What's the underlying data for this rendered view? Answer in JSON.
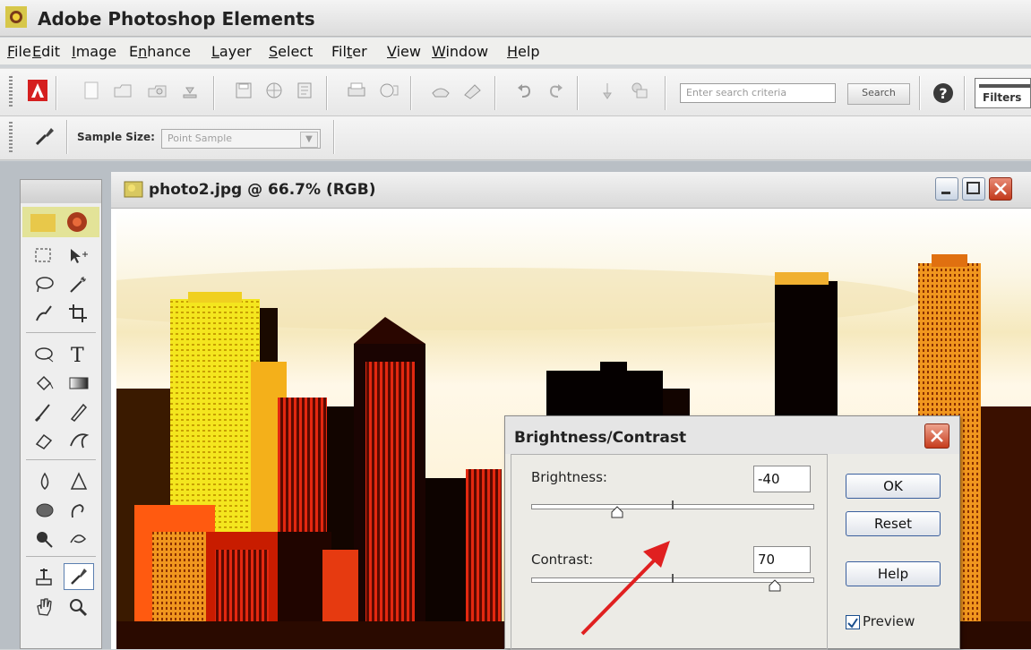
{
  "app": {
    "title": "Adobe Photoshop Elements"
  },
  "menu": [
    {
      "pre": "",
      "u": "F",
      "post": "ile"
    },
    {
      "pre": "",
      "u": "E",
      "post": "dit"
    },
    {
      "pre": "",
      "u": "I",
      "post": "mage"
    },
    {
      "pre": "E",
      "u": "n",
      "post": "hance"
    },
    {
      "pre": "",
      "u": "L",
      "post": "ayer"
    },
    {
      "pre": "",
      "u": "S",
      "post": "elect"
    },
    {
      "pre": "Fil",
      "u": "t",
      "post": "er"
    },
    {
      "pre": "",
      "u": "V",
      "post": "iew"
    },
    {
      "pre": "",
      "u": "W",
      "post": "indow"
    },
    {
      "pre": "",
      "u": "H",
      "post": "elp"
    }
  ],
  "toolbar": {
    "search_placeholder": "Enter search criteria",
    "search_button": "Search",
    "filters_label": "Filters"
  },
  "options": {
    "sample_size_label": "Sample Size:",
    "sample_size_value": "Point Sample"
  },
  "document": {
    "title": "photo2.jpg @ 66.7% (RGB)"
  },
  "dialog": {
    "title": "Brightness/Contrast",
    "brightness_label": "Brightness:",
    "brightness_value": "-40",
    "contrast_label": "Contrast:",
    "contrast_value": "70",
    "ok_label": "OK",
    "reset_label": "Reset",
    "help_label": "Help",
    "preview_label": "Preview",
    "preview_checked": true
  },
  "accent_colors": {
    "arrow": "#e02020",
    "close_button": "#c63c1d"
  }
}
